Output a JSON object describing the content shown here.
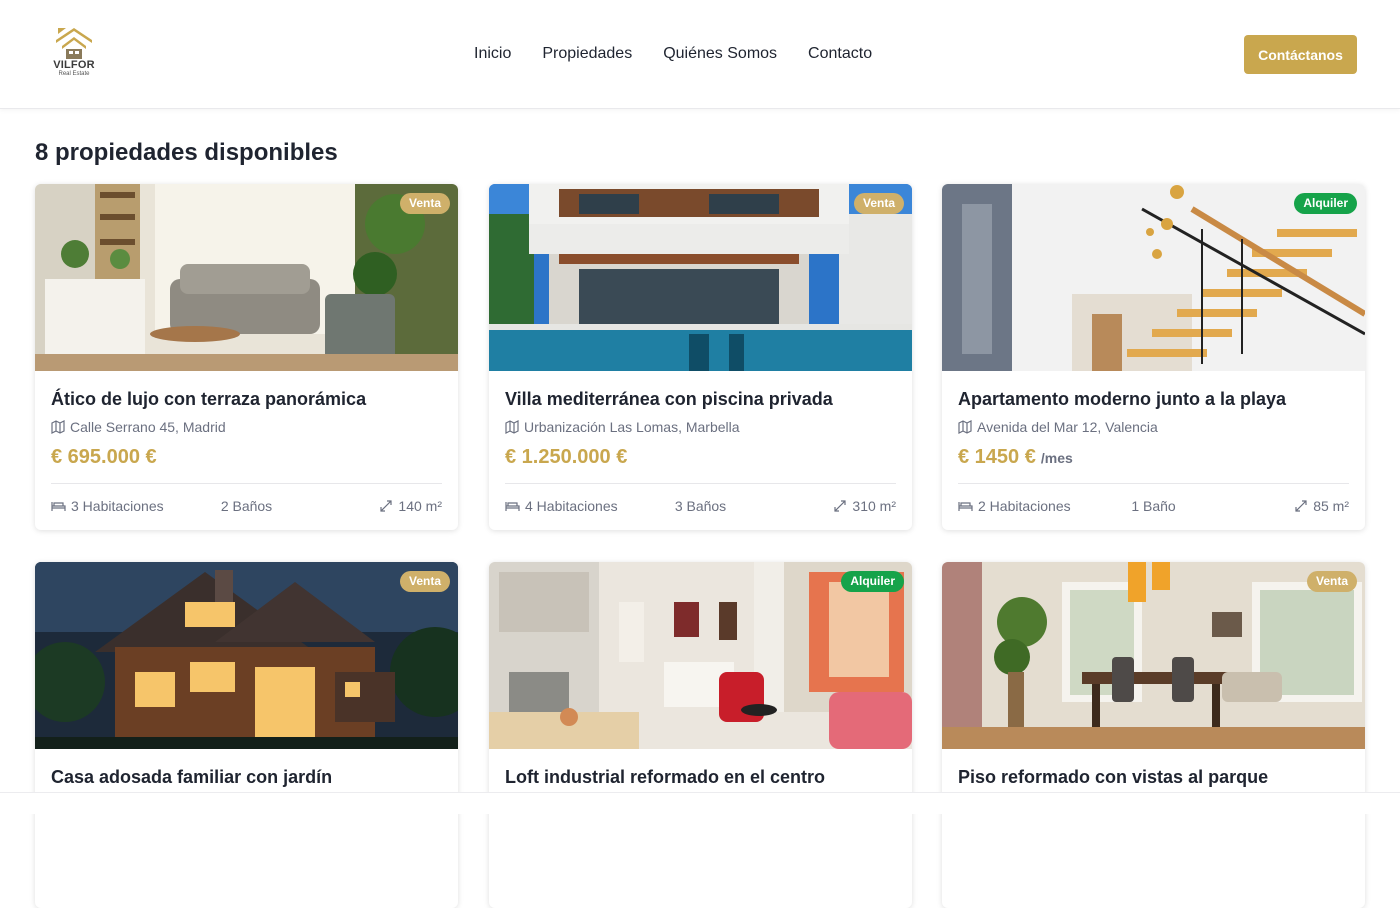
{
  "brand": {
    "name": "VILFOR",
    "tagline": "Real Estate",
    "color": "#c9a74e"
  },
  "nav": [
    {
      "label": "Inicio",
      "name": "nav-inicio"
    },
    {
      "label": "Propiedades",
      "name": "nav-propiedades"
    },
    {
      "label": "Quiénes Somos",
      "name": "nav-quienes-somos"
    },
    {
      "label": "Contacto",
      "name": "nav-contacto"
    }
  ],
  "cta_label": "Contáctanos",
  "heading": "8 propiedades disponibles",
  "colors": {
    "venta": "#cfb06a",
    "alquiler": "#16a34a",
    "price": "#c9a74e"
  },
  "properties": [
    {
      "badge": "Venta",
      "badge_type": "venta",
      "photo": "living-room-photo",
      "title": "Ático de lujo con terraza panorámica",
      "address": "Calle Serrano 45, Madrid",
      "price": "€ 695.000 €",
      "price_suffix": "",
      "rooms": "3 Habitaciones",
      "baths": "2 Baños",
      "area": "140 m²"
    },
    {
      "badge": "Venta",
      "badge_type": "venta",
      "photo": "villa-pool-photo",
      "title": "Villa mediterránea con piscina privada",
      "address": "Urbanización Las Lomas, Marbella",
      "price": "€ 1.250.000 €",
      "price_suffix": "",
      "rooms": "4 Habitaciones",
      "baths": "3 Baños",
      "area": "310 m²"
    },
    {
      "badge": "Alquiler",
      "badge_type": "alquiler",
      "photo": "staircase-photo",
      "title": "Apartamento moderno junto a la playa",
      "address": "Avenida del Mar 12, Valencia",
      "price": "€ 1450 €",
      "price_suffix": "/mes",
      "rooms": "2 Habitaciones",
      "baths": "1 Baño",
      "area": "85 m²"
    },
    {
      "badge": "Venta",
      "badge_type": "venta",
      "photo": "house-night-photo",
      "title": "Casa adosada familiar con jardín"
    },
    {
      "badge": "Alquiler",
      "badge_type": "alquiler",
      "photo": "loft-kitchen-photo",
      "title": "Loft industrial reformado en el centro"
    },
    {
      "badge": "Venta",
      "badge_type": "venta",
      "photo": "dining-room-photo",
      "title": "Piso reformado con vistas al parque"
    }
  ]
}
